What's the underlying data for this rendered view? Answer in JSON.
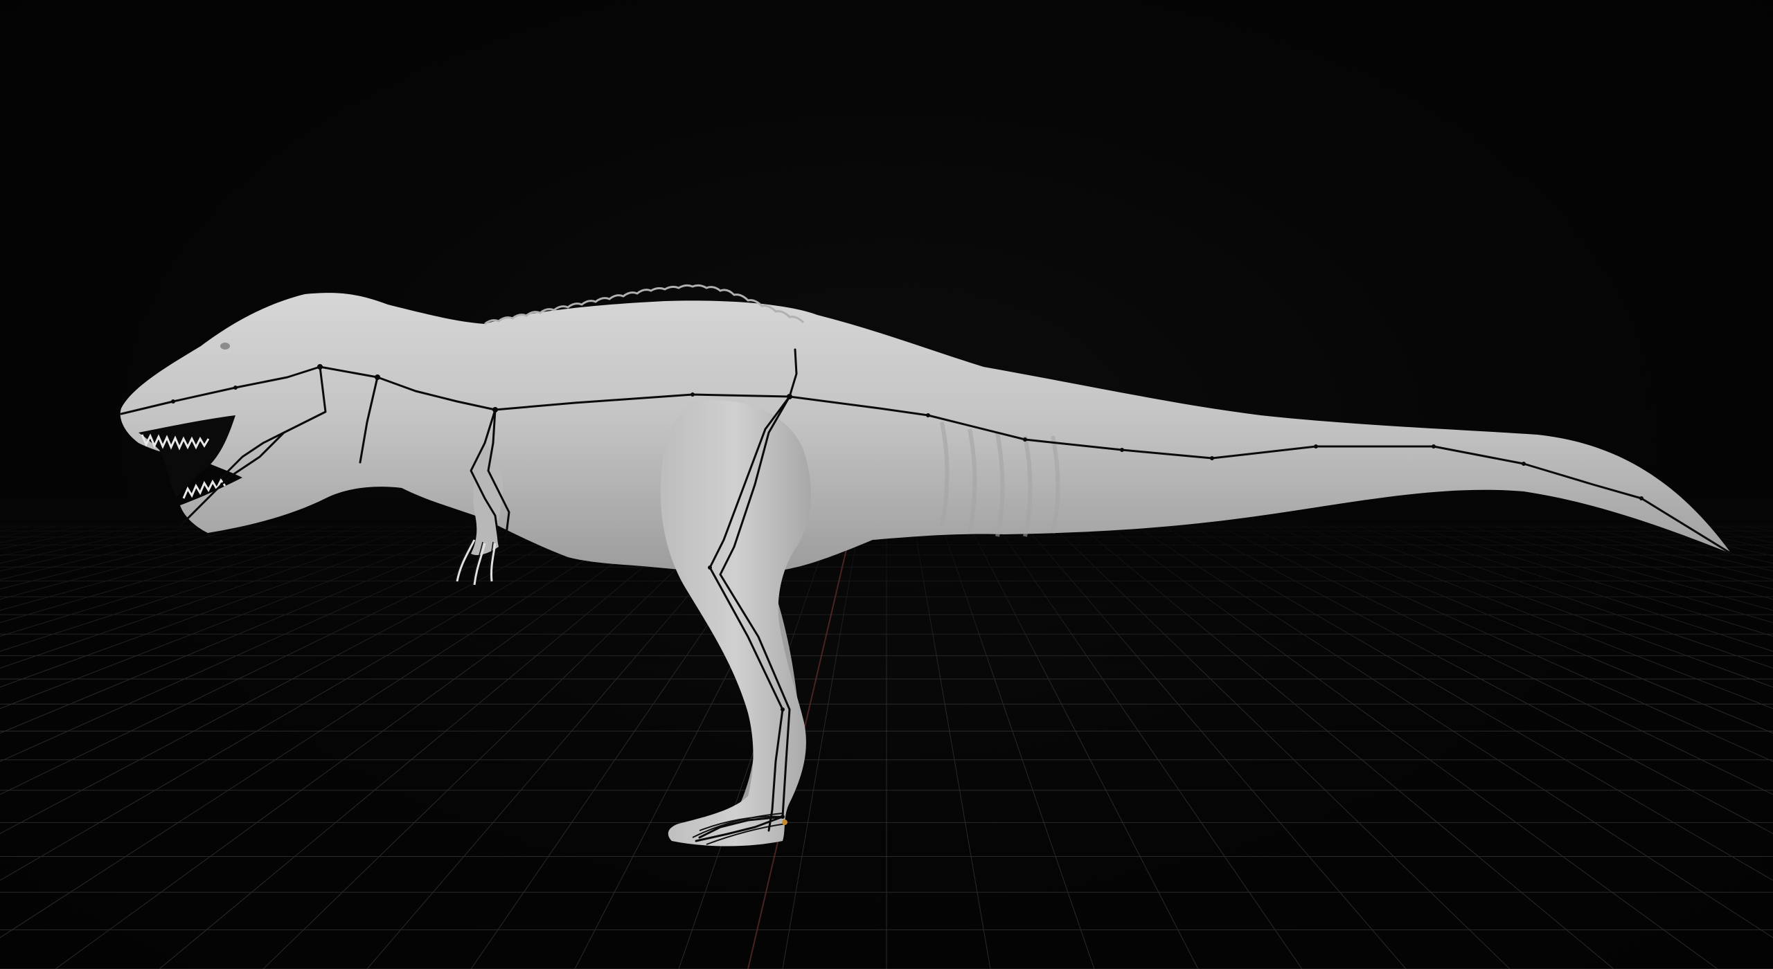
{
  "viewport": {
    "background_color": "#050505",
    "grid_color": "#2a2a2a",
    "model_color": "#c9c9c9",
    "armature_color": "#0a0a0a",
    "axis_color": "#5a2b2b"
  },
  "scene": {
    "model_name_icon": "dinosaur-mesh",
    "armature_icon": "bone-chain",
    "grid_icon": "floor-grid"
  }
}
